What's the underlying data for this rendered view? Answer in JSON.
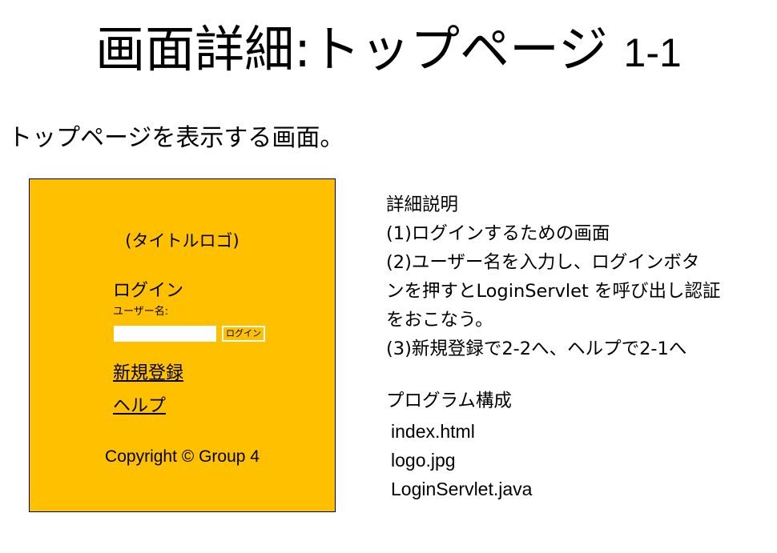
{
  "slide": {
    "title_main": "画面詳細:トップページ",
    "title_number": "1-1",
    "subtitle": "トップページを表示する画面。"
  },
  "mockup": {
    "background_color": "#ffc000",
    "logo_text": "(タイトルロゴ)",
    "login_heading": "ログイン",
    "username_label": "ユーザー名:",
    "username_value": "",
    "login_button_label": "ログイン",
    "register_link": "新規登録",
    "help_link": "ヘルプ",
    "copyright": "Copyright © Group 4"
  },
  "details": {
    "heading": "詳細説明",
    "lines": [
      "(1)ログインするための画面",
      "(2)ユーザー名を入力し、ログインボタ",
      "ンを押すとLoginServlet を呼び出し認証",
      "をおこなう。",
      "(3)新規登録で2-2へ、ヘルプで2-1へ"
    ]
  },
  "program": {
    "heading": "プログラム構成",
    "files": [
      "index.html",
      "logo.jpg",
      "LoginServlet.java"
    ]
  }
}
